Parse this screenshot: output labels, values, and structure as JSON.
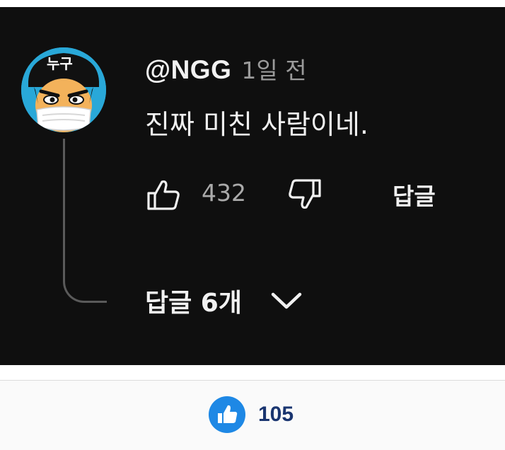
{
  "comment": {
    "author": "@NGG",
    "time": "1일 전",
    "text": "진짜 미친 사람이네.",
    "avatar": {
      "badge_text": "누구",
      "description_icon": "masked-cartoon-avatar-icon"
    },
    "actions": {
      "like_icon": "thumbs-up-icon",
      "like_count": "432",
      "dislike_icon": "thumbs-down-icon",
      "reply_label": "답글"
    },
    "replies": {
      "label": "답글 6개",
      "expand_icon": "chevron-down-icon"
    }
  },
  "footer": {
    "like_icon": "thumbs-up-circle-icon",
    "like_count": "105"
  },
  "colors": {
    "panel_background": "#0f0f0f",
    "primary_text": "#f1f1f1",
    "secondary_text": "#aaaaaa",
    "footer_background": "#fafafa",
    "footer_accent": "#1e88e5",
    "footer_count": "#1a3570"
  }
}
